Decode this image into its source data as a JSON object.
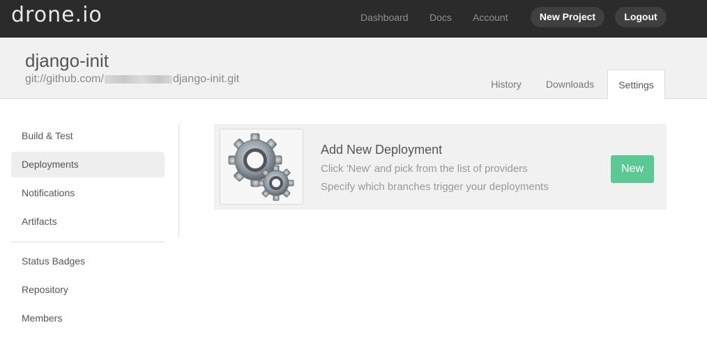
{
  "brand": {
    "logo": "drone.io"
  },
  "nav": {
    "dashboard": "Dashboard",
    "docs": "Docs",
    "account": "Account",
    "new_project": "New Project",
    "logout": "Logout"
  },
  "project": {
    "name": "django-init",
    "url_prefix": "git://github.com/",
    "url_suffix": "django-init.git"
  },
  "tabs": [
    {
      "label": "History"
    },
    {
      "label": "Downloads"
    },
    {
      "label": "Settings",
      "active": true
    }
  ],
  "sidebar": {
    "items": [
      {
        "label": "Build & Test"
      },
      {
        "label": "Deployments",
        "active": true
      },
      {
        "label": "Notifications"
      },
      {
        "label": "Artifacts"
      },
      {
        "label": "Status Badges"
      },
      {
        "label": "Repository"
      },
      {
        "label": "Members"
      }
    ]
  },
  "deployment_card": {
    "icon": "gears-icon",
    "title": "Add New Deployment",
    "line1": "Click 'New' and pick from the list of providers",
    "line2": "Specify which branches trigger your deployments",
    "button": "New"
  },
  "colors": {
    "topbar": "#2b2b2b",
    "accent_green": "#5cc995",
    "header_bg": "#f1f1f1"
  }
}
